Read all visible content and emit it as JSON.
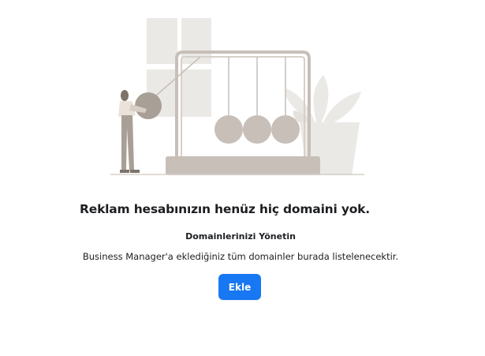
{
  "empty_state": {
    "headline": "Reklam hesabınızın henüz hiç domaini yok.",
    "subheading": "Domainlerinizi Yönetin",
    "description": "Business Manager'a eklediğiniz tüm domainler burada listelenecektir.",
    "add_button_label": "Ekle"
  },
  "colors": {
    "primary_button": "#1877f2",
    "illustration_light": "#ebe9e6",
    "illustration_mid": "#c7bfb8",
    "illustration_dark": "#a89f96",
    "text": "#1c1e21"
  },
  "illustration": {
    "subject": "newtons-cradle-with-person-and-plant"
  }
}
